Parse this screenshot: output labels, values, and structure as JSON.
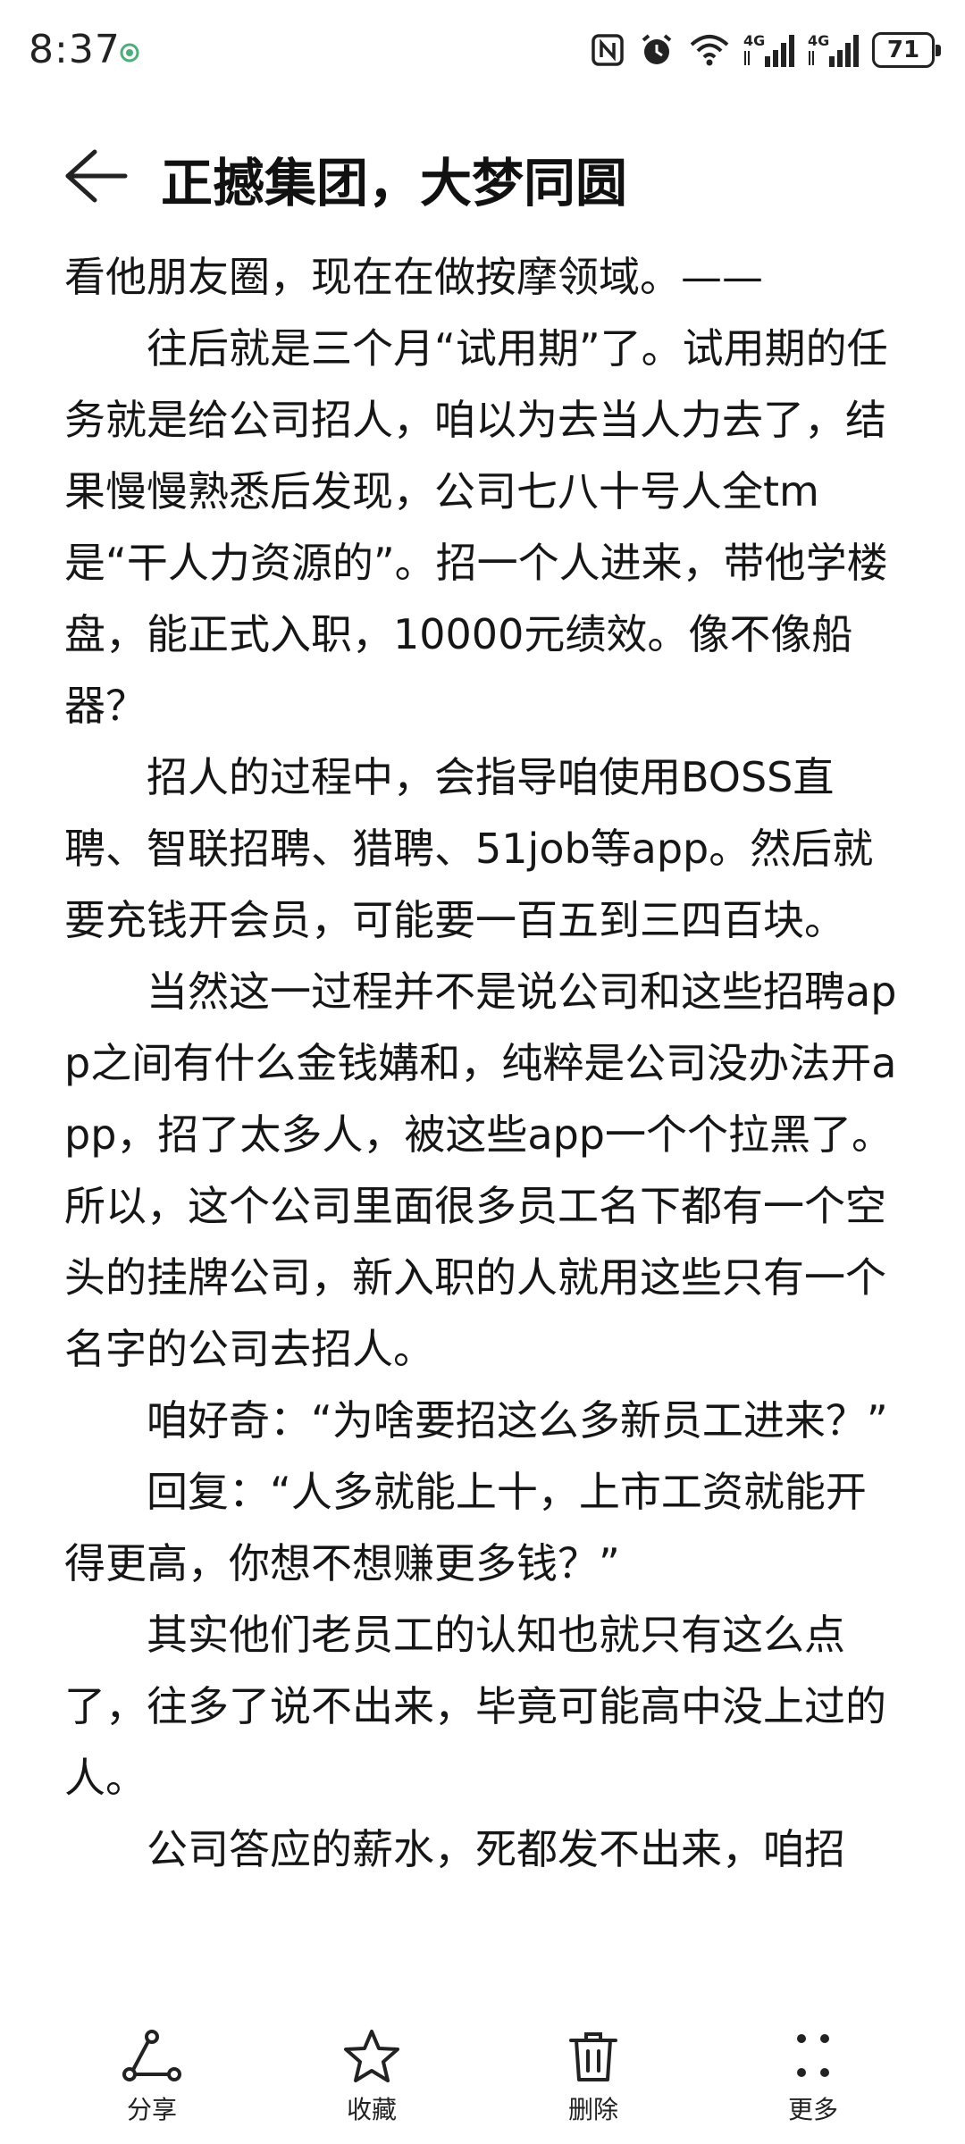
{
  "status_bar": {
    "time": "8:37",
    "signal_label_1": "4G",
    "signal_label_2": "4G",
    "battery": "71"
  },
  "header": {
    "title": "正撼集团，大梦同圆"
  },
  "article": {
    "paragraphs": [
      "看他朋友圈，现在在做按摩领域。——",
      "往后就是三个月“试用期”了。试用期的任务就是给公司招人，咱以为去当人力去了，结果慢慢熟悉后发现，公司七八十号人全tm是“干人力资源的”。招一个人进来，带他学楼盘，能正式入职，10000元绩效。像不像船器？",
      "招人的过程中，会指导咱使用BOSS直聘、智联招聘、猎聘、51job等app。然后就要充钱开会员，可能要一百五到三四百块。",
      "当然这一过程并不是说公司和这些招聘app之间有什么金钱媾和，纯粹是公司没办法开app，招了太多人，被这些app一个个拉黑了。所以，这个公司里面很多员工名下都有一个空头的挂牌公司，新入职的人就用这些只有一个名字的公司去招人。",
      "咱好奇：“为啥要招这么多新员工进来？”",
      "回复：“人多就能上十，上市工资就能开得更高，你想不想赚更多钱？”",
      "其实他们老员工的认知也就只有这么点了，往多了说不出来，毕竟可能高中没上过的人。",
      "公司答应的薪水，死都发不出来，咱招"
    ]
  },
  "toolbar": {
    "share_label": "分享",
    "favorite_label": "收藏",
    "delete_label": "删除",
    "more_label": "更多"
  },
  "icons": {
    "back": "back-arrow-icon",
    "share": "share-icon",
    "favorite": "star-icon",
    "delete": "trash-icon",
    "more": "more-dots-icon"
  }
}
